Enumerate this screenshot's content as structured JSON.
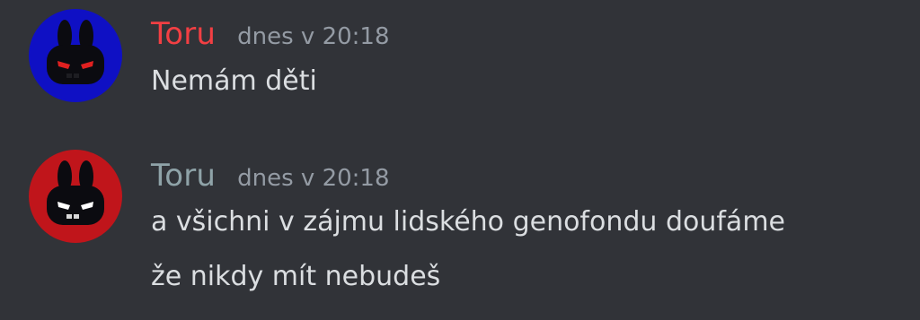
{
  "messages": [
    {
      "username": "Toru",
      "username_color": "#f23f43",
      "timestamp": "dnes v 20:18",
      "avatar_icon": "bunny-avatar-icon",
      "avatar_bg": "#0f10c4",
      "eye_color": "#e02020",
      "lines": [
        "Nemám děti"
      ]
    },
    {
      "username": "Toru",
      "username_color": "#8fa3a8",
      "timestamp": "dnes v 20:18",
      "avatar_icon": "bunny-avatar-icon",
      "avatar_bg": "#c0151b",
      "eye_color": "#ffffff",
      "lines": [
        "a všichni v zájmu lidského genofondu doufáme",
        "že nikdy mít nebudeš"
      ]
    }
  ]
}
